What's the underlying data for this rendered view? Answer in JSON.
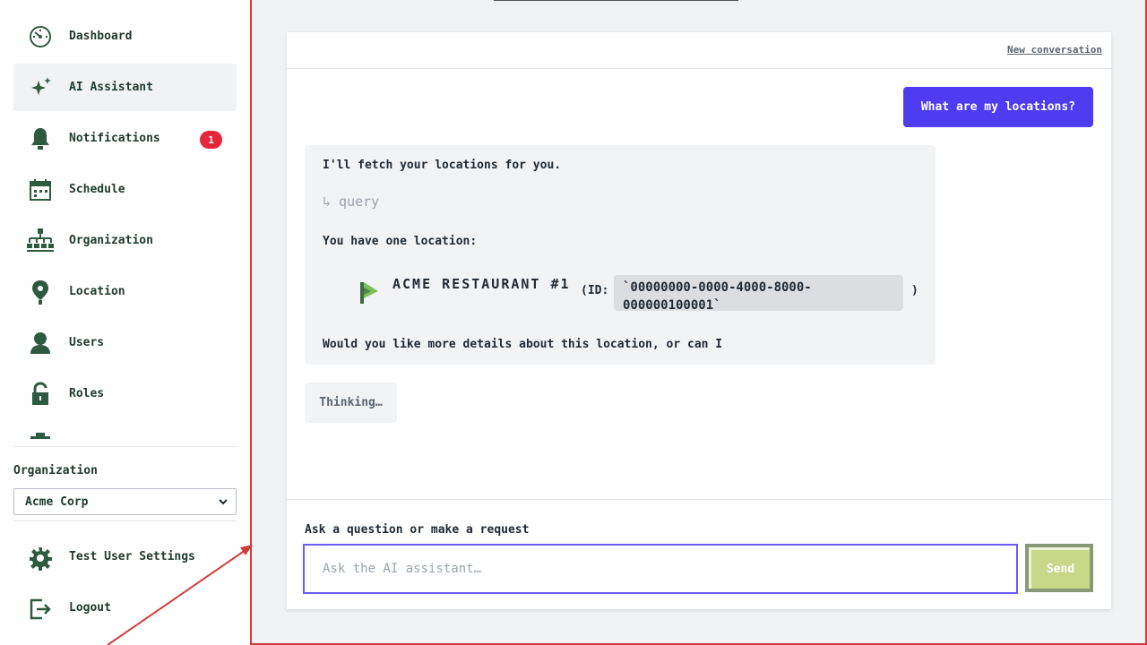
{
  "sidebar": {
    "items": [
      {
        "label": "Dashboard",
        "icon": "dashboard-icon"
      },
      {
        "label": "AI Assistant",
        "icon": "sparkle-icon",
        "active": true
      },
      {
        "label": "Notifications",
        "icon": "bell-icon",
        "badge": "1"
      },
      {
        "label": "Schedule",
        "icon": "calendar-icon"
      },
      {
        "label": "Organization",
        "icon": "org-chart-icon"
      },
      {
        "label": "Location",
        "icon": "map-pin-icon"
      },
      {
        "label": "Users",
        "icon": "user-icon"
      },
      {
        "label": "Roles",
        "icon": "lock-icon"
      }
    ],
    "organization": {
      "label": "Organization",
      "selected": "Acme Corp"
    },
    "bottom": [
      {
        "label": "Test User Settings",
        "icon": "gear-icon"
      },
      {
        "label": "Logout",
        "icon": "logout-icon"
      }
    ]
  },
  "chat": {
    "new_conversation": "New conversation",
    "user_message": "What are my locations?",
    "assistant": {
      "intro": "I'll fetch your locations for you.",
      "tool_call": "↳ query",
      "summary": "You have one location:",
      "location_name": "ACME RESTAURANT #1",
      "id_open": "(ID:",
      "id_value": "`00000000-0000-4000-8000-000000100001`",
      "id_close": ")",
      "followup": "Would you like more details about this location, or can I"
    },
    "thinking": "Thinking…",
    "input": {
      "label": "Ask a question or make a request",
      "placeholder": "Ask the AI assistant…"
    },
    "send_label": "Send"
  },
  "colors": {
    "accent": "#4d3cf0",
    "sidebar_text": "#1f3a2c",
    "badge": "#e5263b",
    "send": "#c7d889",
    "annotation": "#d23b3b"
  }
}
